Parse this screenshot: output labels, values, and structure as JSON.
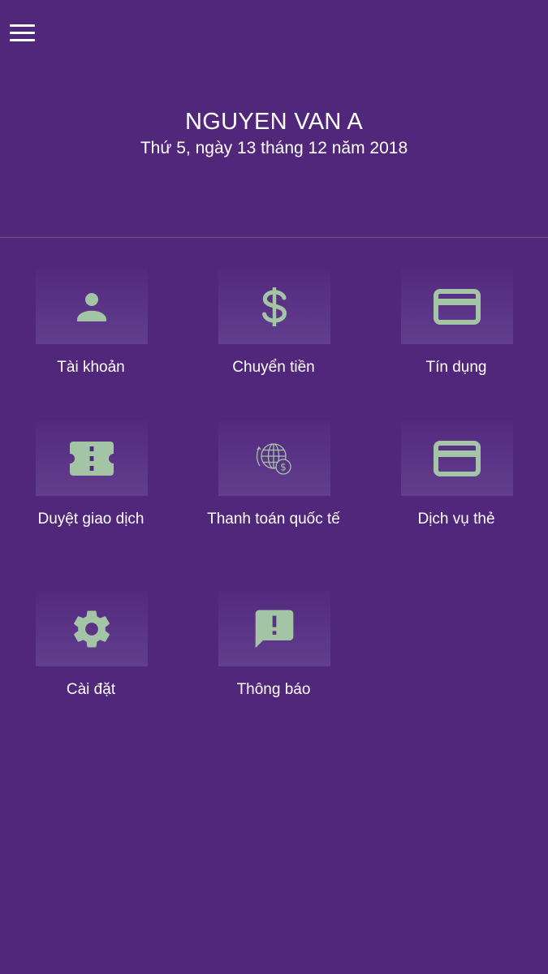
{
  "header": {
    "user_name": "NGUYEN VAN A",
    "date": "Thứ 5, ngày 13 tháng 12 năm 2018"
  },
  "tiles": [
    {
      "label": "Tài khoản",
      "icon": "person-icon"
    },
    {
      "label": "Chuyển tiền",
      "icon": "dollar-icon"
    },
    {
      "label": "Tín dụng",
      "icon": "credit-card-icon"
    },
    {
      "label": "Duyệt giao dịch",
      "icon": "ticket-icon"
    },
    {
      "label": "Thanh toán quốc tế",
      "icon": "globe-dollar-icon"
    },
    {
      "label": "Dịch vụ thẻ",
      "icon": "credit-card-icon"
    },
    {
      "label": "Cài đặt",
      "icon": "gear-icon"
    },
    {
      "label": "Thông báo",
      "icon": "alert-message-icon"
    }
  ],
  "colors": {
    "background": "#50277b",
    "icon": "#a4c4a6",
    "text": "#ffffff"
  }
}
